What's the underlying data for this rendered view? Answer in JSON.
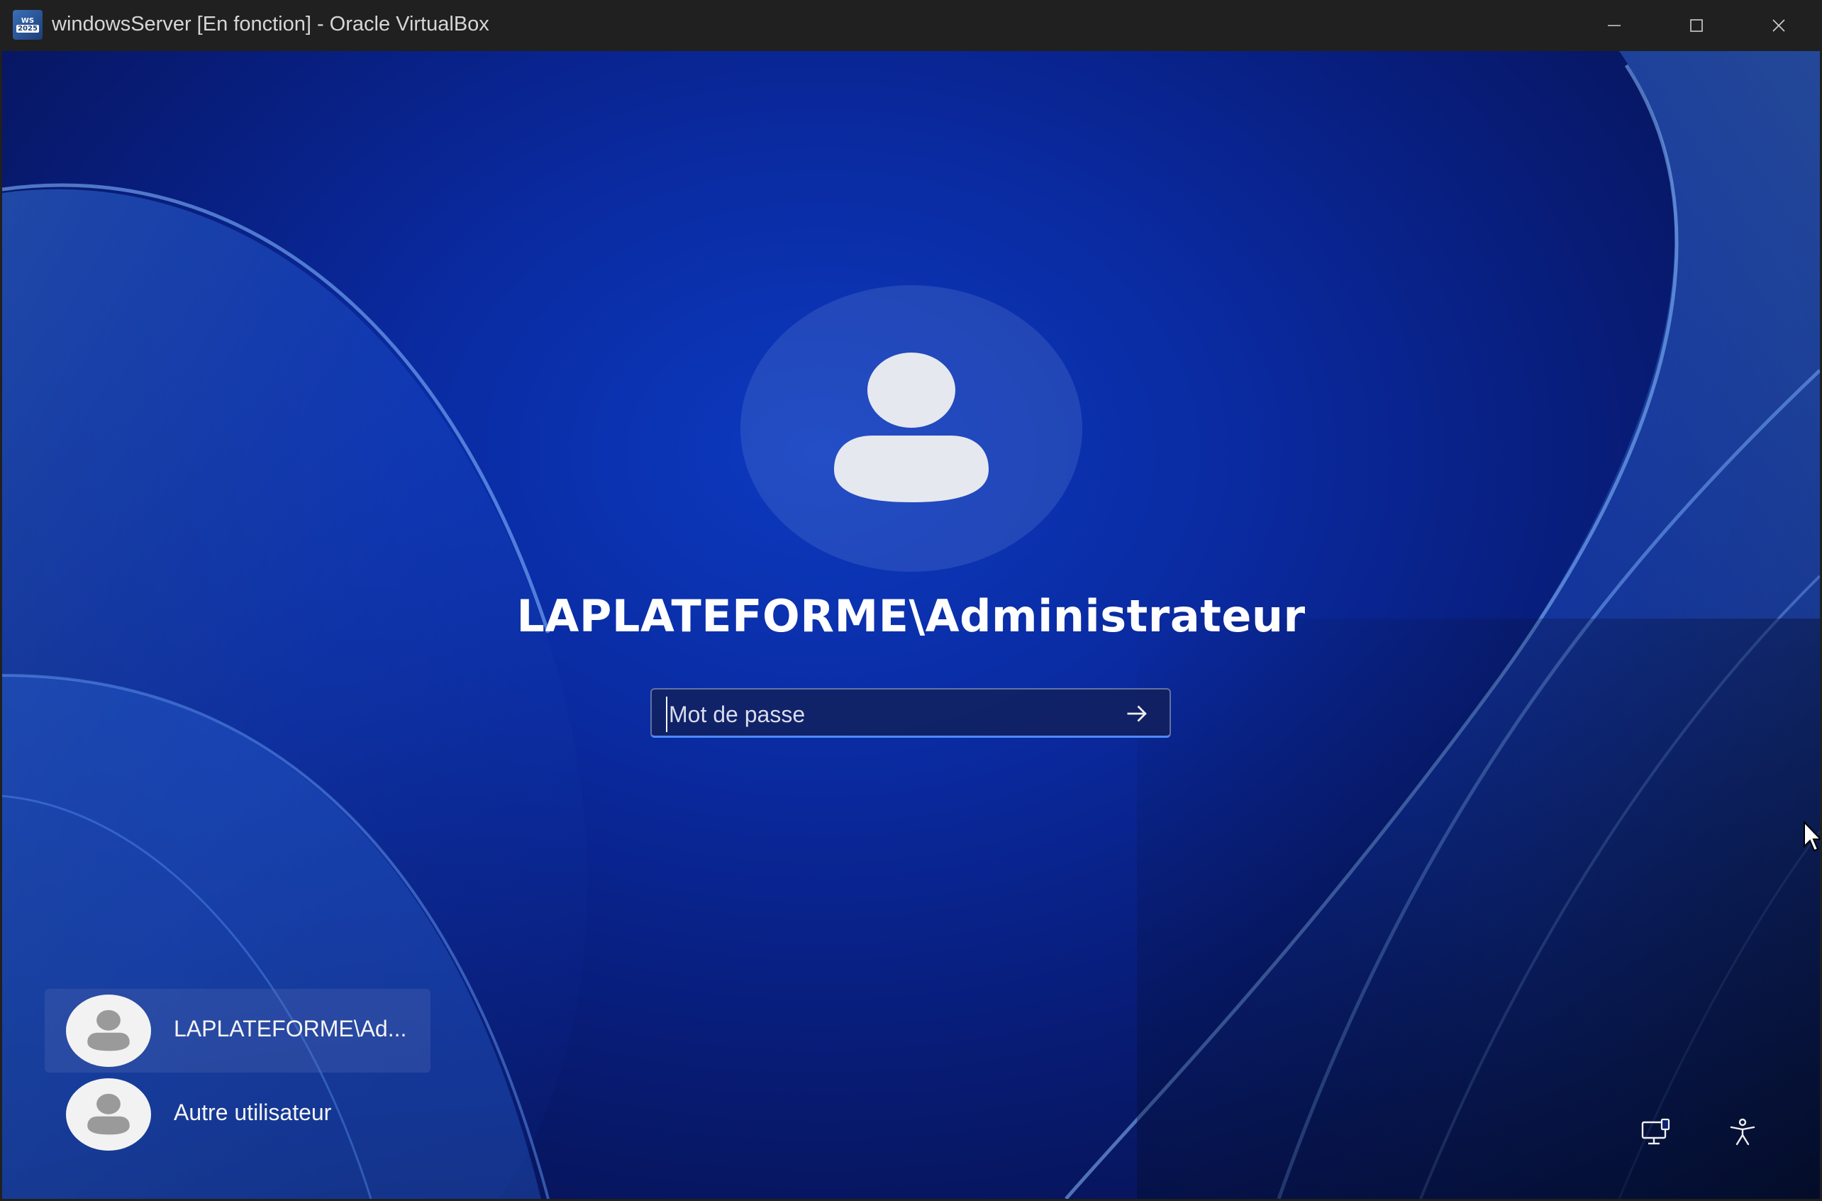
{
  "window": {
    "title": "windowsServer [En fonction] - Oracle VirtualBox",
    "icon": {
      "name": "virtualbox-vm-icon",
      "line1": "WS",
      "line2": "2025"
    },
    "controls": {
      "minimize": "minimize-icon",
      "maximize": "maximize-icon",
      "close": "close-icon"
    }
  },
  "login": {
    "username": "LAPLATEFORME\\Administrateur",
    "password": {
      "value": "",
      "placeholder": "Mot de passe"
    },
    "submit_icon": "arrow-right-icon"
  },
  "user_list": [
    {
      "label": "LAPLATEFORME\\Ad...",
      "selected": true
    },
    {
      "label": "Autre utilisateur",
      "selected": false
    }
  ],
  "corner_icons": {
    "network": "network-icon",
    "accessibility": "accessibility-icon"
  },
  "colors": {
    "titlebar": "#202020",
    "wallpaper_blue": "#0a2aa0",
    "input_focus": "#4f8bff"
  }
}
